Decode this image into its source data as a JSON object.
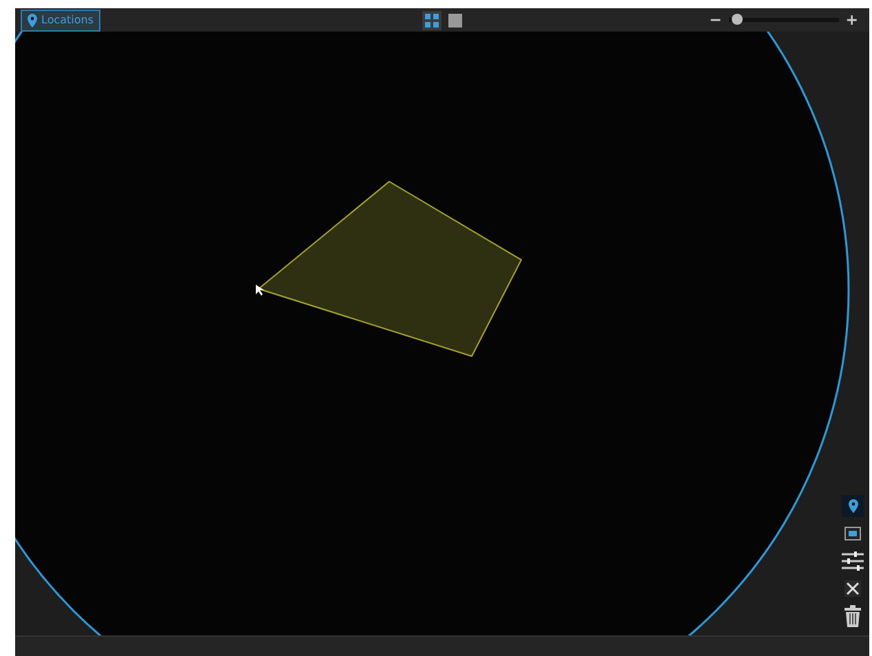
{
  "toolbar": {
    "tab": {
      "label": "Locations",
      "selected": true
    },
    "view_modes": [
      {
        "kind": "grid",
        "selected": true
      },
      {
        "kind": "single",
        "selected": false
      }
    ],
    "zoom": {
      "minus": "−",
      "plus": "+",
      "level": 0.08
    }
  },
  "tools": [
    {
      "kind": "pin",
      "selected": true
    },
    {
      "kind": "screen",
      "selected": false
    },
    {
      "kind": "sliders",
      "selected": false
    },
    {
      "kind": "expand",
      "selected": false
    },
    {
      "kind": "trash",
      "selected": false
    }
  ]
}
